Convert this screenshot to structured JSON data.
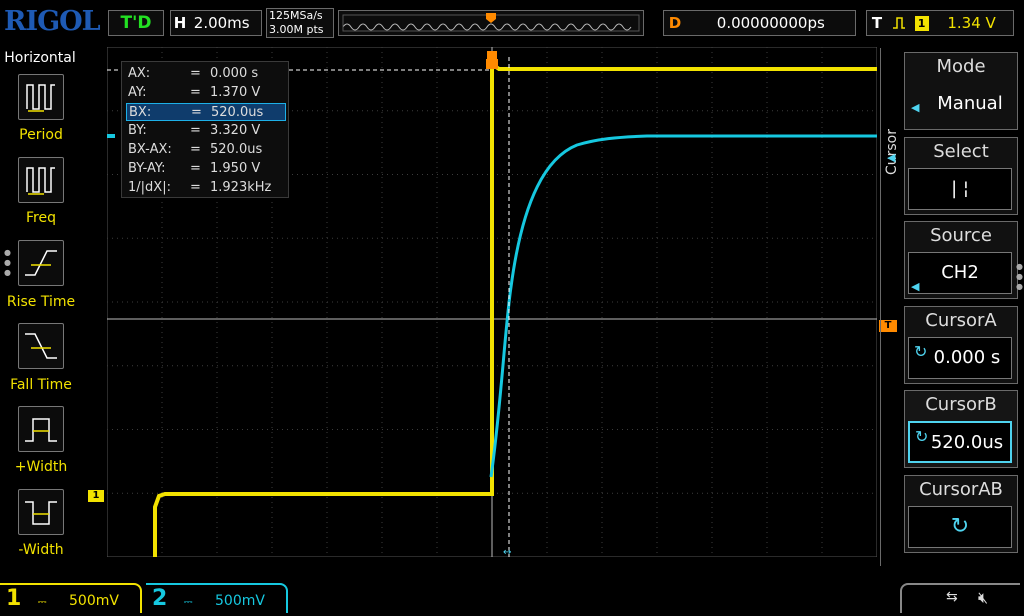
{
  "topbar": {
    "logo": "RIGOL",
    "run_state": "T'D",
    "timebase_key": "H",
    "timebase_value": "2.00ms",
    "sample_rate": "125MSa/s",
    "memory_depth": "3.00M pts",
    "delay_key": "D",
    "delay_value": "0.00000000ps",
    "trigger_key": "T",
    "trigger_source": "1",
    "trigger_level": "1.34 V"
  },
  "left_menu": {
    "title": "Horizontal",
    "items": [
      {
        "label": "Period",
        "icon": "period-icon"
      },
      {
        "label": "Freq",
        "icon": "frequency-icon"
      },
      {
        "label": "Rise Time",
        "icon": "rise-time-icon"
      },
      {
        "label": "Fall Time",
        "icon": "fall-time-icon"
      },
      {
        "label": "+Width",
        "icon": "positive-width-icon"
      },
      {
        "label": "-Width",
        "icon": "negative-width-icon"
      }
    ]
  },
  "cursor_readout": {
    "rows": [
      {
        "name": "AX:",
        "eq": "=",
        "value": "0.000 s"
      },
      {
        "name": "AY:",
        "eq": "=",
        "value": "1.370 V"
      },
      {
        "name": "BX:",
        "eq": "=",
        "value": "520.0us"
      },
      {
        "name": "BY:",
        "eq": "=",
        "value": "3.320 V"
      },
      {
        "name": "BX-AX:",
        "eq": "=",
        "value": "520.0us"
      },
      {
        "name": "BY-AY:",
        "eq": "=",
        "value": "1.950 V"
      },
      {
        "name": "1/|dX|:",
        "eq": "=",
        "value": "1.923kHz"
      }
    ],
    "highlighted_row": 2
  },
  "right_menu": {
    "tab_label": "Cursor",
    "items": [
      {
        "header": "Mode",
        "value": "Manual"
      },
      {
        "header": "Select",
        "value": "|   ¦"
      },
      {
        "header": "Source",
        "value": "CH2"
      },
      {
        "header": "CursorA",
        "value": "0.000 s"
      },
      {
        "header": "CursorB",
        "value": "520.0us"
      },
      {
        "header": "CursorAB",
        "value": ""
      }
    ],
    "selected_index": 4
  },
  "channels": [
    {
      "number": "1",
      "scale": "500mV",
      "color": "#f2e200"
    },
    {
      "number": "2",
      "scale": "500mV",
      "color": "#16c8e0"
    }
  ],
  "markers": {
    "ch1": "1",
    "trigger": "T"
  },
  "colors": {
    "ch1": "#f2e200",
    "ch2": "#16c8e0",
    "accent": "#ff8a00",
    "brand": "#1e5ab4"
  }
}
